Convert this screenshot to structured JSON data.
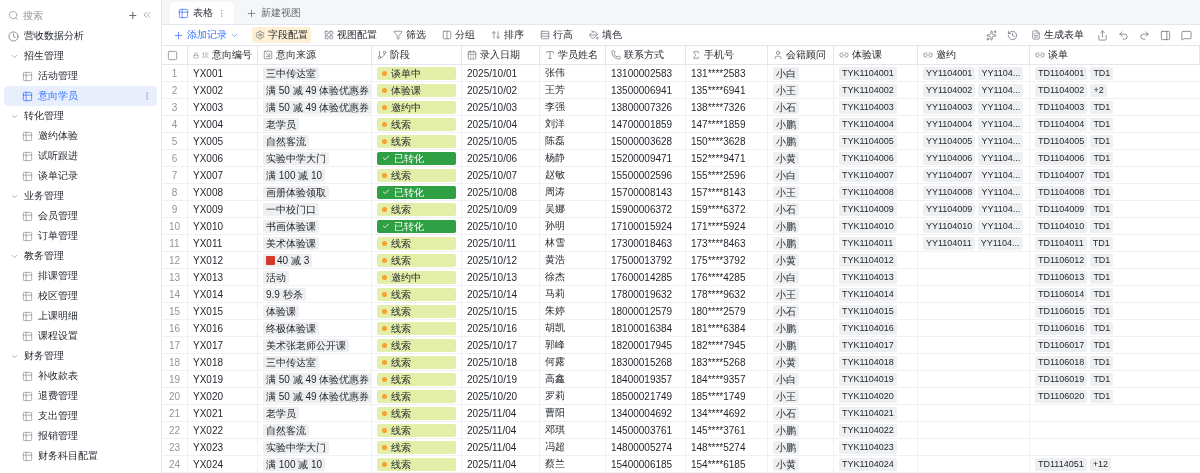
{
  "sidebar": {
    "search": {
      "placeholder": "搜索"
    },
    "add_label": "+",
    "items": [
      {
        "label": "营收数据分析",
        "kind": "dashboard",
        "selected": false
      },
      {
        "label": "招生管理",
        "kind": "group",
        "expanded": true,
        "children": [
          {
            "label": "活动管理",
            "selected": false
          },
          {
            "label": "意向学员",
            "selected": true
          }
        ]
      },
      {
        "label": "转化管理",
        "kind": "group",
        "expanded": true,
        "children": [
          {
            "label": "邀约体验",
            "selected": false
          },
          {
            "label": "试听跟进",
            "selected": false
          },
          {
            "label": "谈单记录",
            "selected": false
          }
        ]
      },
      {
        "label": "业务管理",
        "kind": "group",
        "expanded": true,
        "children": [
          {
            "label": "会员管理",
            "selected": false
          },
          {
            "label": "订单管理",
            "selected": false
          }
        ]
      },
      {
        "label": "教务管理",
        "kind": "group",
        "expanded": true,
        "children": [
          {
            "label": "排课管理",
            "selected": false
          },
          {
            "label": "校区管理",
            "selected": false
          },
          {
            "label": "上课明细",
            "selected": false
          },
          {
            "label": "课程设置",
            "selected": false
          }
        ]
      },
      {
        "label": "财务管理",
        "kind": "group",
        "expanded": true,
        "children": [
          {
            "label": "补收款表",
            "selected": false
          },
          {
            "label": "退费管理",
            "selected": false
          },
          {
            "label": "支出管理",
            "selected": false
          },
          {
            "label": "报销管理",
            "selected": false
          },
          {
            "label": "财务科目配置",
            "selected": false
          }
        ]
      }
    ]
  },
  "tabs": [
    {
      "label": "表格",
      "selected": true
    },
    {
      "label": "新建视图",
      "selected": false
    }
  ],
  "toolbar": {
    "add_record": "添加记录",
    "buttons": [
      {
        "label": "字段配置",
        "highlighted": true
      },
      {
        "label": "视图配置",
        "highlighted": false
      },
      {
        "label": "筛选",
        "highlighted": false
      },
      {
        "label": "分组",
        "highlighted": false
      },
      {
        "label": "排序",
        "highlighted": false
      },
      {
        "label": "行高",
        "highlighted": false
      },
      {
        "label": "填色",
        "highlighted": false
      }
    ],
    "generate_form": "生成表单"
  },
  "table": {
    "select_all_checked": false,
    "columns": [
      "意向编号",
      "意向来源",
      "阶段",
      "录入日期",
      "学员姓名",
      "联系方式",
      "手机号",
      "会籍顾问",
      "体验课",
      "邀约",
      "谈单"
    ],
    "rows": [
      {
        "no": "1",
        "id": "YX001",
        "source": "三中传达室",
        "stage": {
          "label": "谈单中",
          "converted": false
        },
        "date": "2025/10/01",
        "name": "张伟",
        "contact": "13100002583",
        "phone": "131****2583",
        "advisor": "小白",
        "trial": "TYK1104001",
        "invites": [
          "YY1104001",
          "YY1104..."
        ],
        "deals": [
          "TD1104001",
          "TD1"
        ]
      },
      {
        "no": "2",
        "id": "YX002",
        "source": "满 50 减 49 体验优惠券",
        "stage": {
          "label": "体验课",
          "converted": false
        },
        "date": "2025/10/02",
        "name": "王芳",
        "contact": "13500006941",
        "phone": "135****6941",
        "advisor": "小王",
        "trial": "TYK1104002",
        "invites": [
          "YY1104002",
          "YY1104..."
        ],
        "deals": [
          "TD1104002",
          "+2"
        ]
      },
      {
        "no": "3",
        "id": "YX003",
        "source": "满 50 减 49 体验优惠券",
        "stage": {
          "label": "邀约中",
          "converted": false
        },
        "date": "2025/10/03",
        "name": "李强",
        "contact": "13800007326",
        "phone": "138****7326",
        "advisor": "小石",
        "trial": "TYK1104003",
        "invites": [
          "YY1104003",
          "YY1104..."
        ],
        "deals": [
          "TD1104003",
          "TD1"
        ]
      },
      {
        "no": "4",
        "id": "YX004",
        "source": "老学员",
        "stage": {
          "label": "线索",
          "converted": false
        },
        "date": "2025/10/04",
        "name": "刘洋",
        "contact": "14700001859",
        "phone": "147****1859",
        "advisor": "小鹏",
        "trial": "TYK1104004",
        "invites": [
          "YY1104004",
          "YY1104..."
        ],
        "deals": [
          "TD1104004",
          "TD1"
        ]
      },
      {
        "no": "5",
        "id": "YX005",
        "source": "自然客流",
        "stage": {
          "label": "线索",
          "converted": false
        },
        "date": "2025/10/05",
        "name": "陈磊",
        "contact": "15000003628",
        "phone": "150****3628",
        "advisor": "小鹏",
        "trial": "TYK1104005",
        "invites": [
          "YY1104005",
          "YY1104..."
        ],
        "deals": [
          "TD1104005",
          "TD1"
        ]
      },
      {
        "no": "6",
        "id": "YX006",
        "source": "实验中学大门",
        "stage": {
          "label": "已转化",
          "converted": true
        },
        "date": "2025/10/06",
        "name": "杨静",
        "contact": "15200009471",
        "phone": "152****9471",
        "advisor": "小黄",
        "trial": "TYK1104006",
        "invites": [
          "YY1104006",
          "YY1104..."
        ],
        "deals": [
          "TD1104006",
          "TD1"
        ]
      },
      {
        "no": "7",
        "id": "YX007",
        "source": "满 100 减 10",
        "stage": {
          "label": "线索",
          "converted": false
        },
        "date": "2025/10/07",
        "name": "赵敏",
        "contact": "15500002596",
        "phone": "155****2596",
        "advisor": "小白",
        "trial": "TYK1104007",
        "invites": [
          "YY1104007",
          "YY1104..."
        ],
        "deals": [
          "TD1104007",
          "TD1"
        ]
      },
      {
        "no": "8",
        "id": "YX008",
        "source": "画册体验领取",
        "stage": {
          "label": "已转化",
          "converted": true
        },
        "date": "2025/10/08",
        "name": "周涛",
        "contact": "15700008143",
        "phone": "157****8143",
        "advisor": "小王",
        "trial": "TYK1104008",
        "invites": [
          "YY1104008",
          "YY1104..."
        ],
        "deals": [
          "TD1104008",
          "TD1"
        ]
      },
      {
        "no": "9",
        "id": "YX009",
        "source": "一中校门口",
        "stage": {
          "label": "线索",
          "converted": false
        },
        "date": "2025/10/09",
        "name": "吴娜",
        "contact": "15900006372",
        "phone": "159****6372",
        "advisor": "小石",
        "trial": "TYK1104009",
        "invites": [
          "YY1104009",
          "YY1104..."
        ],
        "deals": [
          "TD1104009",
          "TD1"
        ]
      },
      {
        "no": "10",
        "id": "YX010",
        "source": "书画体验课",
        "stage": {
          "label": "已转化",
          "converted": true
        },
        "date": "2025/10/10",
        "name": "孙明",
        "contact": "17100015924",
        "phone": "171****5924",
        "advisor": "小鹏",
        "trial": "TYK1104010",
        "invites": [
          "YY1104010",
          "YY1104..."
        ],
        "deals": [
          "TD1104010",
          "TD1"
        ]
      },
      {
        "no": "11",
        "id": "YX011",
        "source": "美术体验课",
        "stage": {
          "label": "线索",
          "converted": false
        },
        "date": "2025/10/11",
        "name": "林雪",
        "contact": "17300018463",
        "phone": "173****8463",
        "advisor": "小鹏",
        "trial": "TYK1104011",
        "invites": [
          "YY1104011",
          "YY1104..."
        ],
        "deals": [
          "TD1104011",
          "TD1"
        ]
      },
      {
        "no": "12",
        "id": "YX012",
        "source": "40 减 3",
        "source_icon": true,
        "stage": {
          "label": "线索",
          "converted": false
        },
        "date": "2025/10/12",
        "name": "黄浩",
        "contact": "17500013792",
        "phone": "175****3792",
        "advisor": "小黄",
        "trial": "TYK1104012",
        "deals": [
          "TD1106012",
          "TD1"
        ]
      },
      {
        "no": "13",
        "id": "YX013",
        "source": "活动",
        "stage": {
          "label": "邀约中",
          "converted": false
        },
        "date": "2025/10/13",
        "name": "徐杰",
        "contact": "17600014285",
        "phone": "176****4285",
        "advisor": "小白",
        "trial": "TYK1104013",
        "deals": [
          "TD1106013",
          "TD1"
        ]
      },
      {
        "no": "14",
        "id": "YX014",
        "source": "9.9 秒杀",
        "stage": {
          "label": "线索",
          "converted": false
        },
        "date": "2025/10/14",
        "name": "马莉",
        "contact": "17800019632",
        "phone": "178****9632",
        "advisor": "小王",
        "trial": "TYK1104014",
        "deals": [
          "TD1106014",
          "TD1"
        ]
      },
      {
        "no": "15",
        "id": "YX015",
        "source": "体验课",
        "stage": {
          "label": "线索",
          "converted": false
        },
        "date": "2025/10/15",
        "name": "朱婷",
        "contact": "18000012579",
        "phone": "180****2579",
        "advisor": "小石",
        "trial": "TYK1104015",
        "deals": [
          "TD1106015",
          "TD1"
        ]
      },
      {
        "no": "16",
        "id": "YX016",
        "source": "终极体验课",
        "stage": {
          "label": "线索",
          "converted": false
        },
        "date": "2025/10/16",
        "name": "胡凯",
        "contact": "18100016384",
        "phone": "181****6384",
        "advisor": "小鹏",
        "trial": "TYK1104016",
        "deals": [
          "TD1106016",
          "TD1"
        ]
      },
      {
        "no": "17",
        "id": "YX017",
        "source": "美术张老师公开课",
        "stage": {
          "label": "线索",
          "converted": false
        },
        "date": "2025/10/17",
        "name": "郭峰",
        "contact": "18200017945",
        "phone": "182****7945",
        "advisor": "小鹏",
        "trial": "TYK1104017",
        "deals": [
          "TD1106017",
          "TD1"
        ]
      },
      {
        "no": "18",
        "id": "YX018",
        "source": "三中传达室",
        "stage": {
          "label": "线索",
          "converted": false
        },
        "date": "2025/10/18",
        "name": "何露",
        "contact": "18300015268",
        "phone": "183****5268",
        "advisor": "小黄",
        "trial": "TYK1104018",
        "deals": [
          "TD1106018",
          "TD1"
        ]
      },
      {
        "no": "19",
        "id": "YX019",
        "source": "满 50 减 49 体验优惠券",
        "stage": {
          "label": "线索",
          "converted": false
        },
        "date": "2025/10/19",
        "name": "高鑫",
        "contact": "18400019357",
        "phone": "184****9357",
        "advisor": "小白",
        "trial": "TYK1104019",
        "deals": [
          "TD1106019",
          "TD1"
        ]
      },
      {
        "no": "20",
        "id": "YX020",
        "source": "满 50 减 49 体验优惠券",
        "stage": {
          "label": "线索",
          "converted": false
        },
        "date": "2025/10/20",
        "name": "罗莉",
        "contact": "18500021749",
        "phone": "185****1749",
        "advisor": "小王",
        "trial": "TYK1104020",
        "deals": [
          "TD1106020",
          "TD1"
        ]
      },
      {
        "no": "21",
        "id": "YX021",
        "source": "老学员",
        "stage": {
          "label": "线索",
          "converted": false
        },
        "date": "2025/11/04",
        "name": "曹阳",
        "contact": "13400004692",
        "phone": "134****4692",
        "advisor": "小石",
        "trial": "TYK1104021"
      },
      {
        "no": "22",
        "id": "YX022",
        "source": "自然客流",
        "stage": {
          "label": "线索",
          "converted": false
        },
        "date": "2025/11/04",
        "name": "邓琪",
        "contact": "14500003761",
        "phone": "145****3761",
        "advisor": "小鹏",
        "trial": "TYK1104022"
      },
      {
        "no": "23",
        "id": "YX023",
        "source": "实验中学大门",
        "stage": {
          "label": "线索",
          "converted": false
        },
        "date": "2025/11/04",
        "name": "冯超",
        "contact": "14800005274",
        "phone": "148****5274",
        "advisor": "小鹏",
        "trial": "TYK1104023"
      },
      {
        "no": "24",
        "id": "YX024",
        "source": "满 100 减 10",
        "stage": {
          "label": "线索",
          "converted": false
        },
        "date": "2025/11/04",
        "name": "蔡兰",
        "contact": "15400006185",
        "phone": "154****6185",
        "advisor": "小黄",
        "trial": "TYK1104024",
        "deals": [
          "TD1114051",
          "+12"
        ]
      }
    ]
  }
}
